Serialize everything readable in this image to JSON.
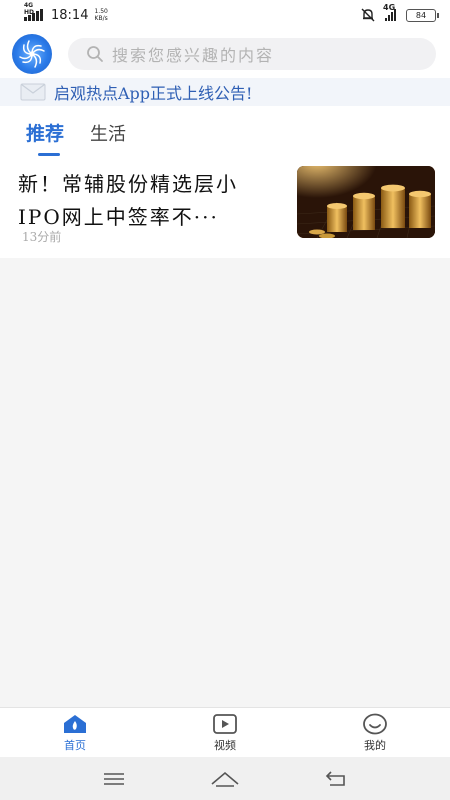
{
  "status_bar": {
    "network_left": "4G HD",
    "time": "18:14",
    "speed_value": "1.50",
    "speed_unit": "KB/s",
    "network_right": "4G",
    "battery": "84"
  },
  "header": {
    "search_placeholder": "搜索您感兴趣的内容"
  },
  "notice": {
    "text": "启观热点App正式上线公告!"
  },
  "tabs": [
    {
      "label": "推荐",
      "active": true
    },
    {
      "label": "生活",
      "active": false
    }
  ],
  "news": [
    {
      "title": "新！常辅股份精选层小IPO网上中签率不···",
      "time": "13分前"
    }
  ],
  "bottom_nav": [
    {
      "label": "首页",
      "icon": "home-icon",
      "active": true
    },
    {
      "label": "视频",
      "icon": "video-icon",
      "active": false
    },
    {
      "label": "我的",
      "icon": "profile-icon",
      "active": false
    }
  ],
  "colors": {
    "accent": "#2b6fd4",
    "notice_text": "#2f5fb4",
    "background": "#f5f5f5"
  }
}
